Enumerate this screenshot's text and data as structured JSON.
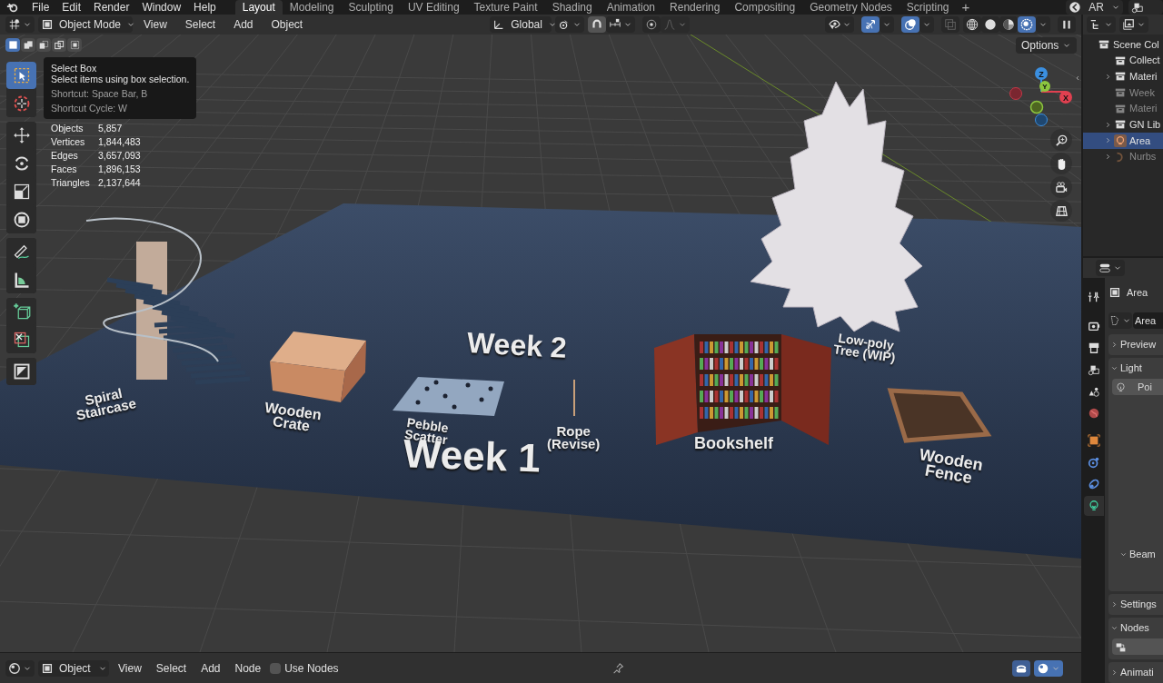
{
  "top_menu": [
    "File",
    "Edit",
    "Render",
    "Window",
    "Help"
  ],
  "workspaces": [
    {
      "label": "Layout",
      "selected": true
    },
    {
      "label": "Modeling",
      "selected": false
    },
    {
      "label": "Sculpting",
      "selected": false
    },
    {
      "label": "UV Editing",
      "selected": false
    },
    {
      "label": "Texture Paint",
      "selected": false
    },
    {
      "label": "Shading",
      "selected": false
    },
    {
      "label": "Animation",
      "selected": false
    },
    {
      "label": "Rendering",
      "selected": false
    },
    {
      "label": "Compositing",
      "selected": false
    },
    {
      "label": "Geometry Nodes",
      "selected": false
    },
    {
      "label": "Scripting",
      "selected": false
    }
  ],
  "add_workspace": "+",
  "scene": {
    "name": "AR"
  },
  "viewport_header": {
    "mode": "Object Mode",
    "menus": [
      "View",
      "Select",
      "Add",
      "Object"
    ],
    "orientation": "Global",
    "snapping": {
      "on": true
    },
    "proportional_editing": {
      "on": false
    },
    "gizmos": {
      "on": true
    },
    "overlays": {
      "on": true
    },
    "xray": {
      "on": false
    },
    "shading": [
      {
        "kind": "wireframe",
        "selected": false
      },
      {
        "kind": "solid",
        "selected": false
      },
      {
        "kind": "material",
        "selected": false
      },
      {
        "kind": "rendered",
        "selected": true
      }
    ]
  },
  "select_modes": [
    {
      "kind": "new",
      "selected": true
    },
    {
      "kind": "extend",
      "selected": false
    },
    {
      "kind": "subtract",
      "selected": false
    },
    {
      "kind": "invert",
      "selected": false
    },
    {
      "kind": "intersect",
      "selected": false
    }
  ],
  "options": "Options",
  "axis_gizmo": [
    "Z",
    "Y",
    "X"
  ],
  "tool_groups": [
    [
      {
        "kind": "select-box",
        "selected": true
      },
      {
        "kind": "cursor",
        "selected": false
      }
    ],
    [
      {
        "kind": "move",
        "selected": false
      },
      {
        "kind": "rotate",
        "selected": false
      },
      {
        "kind": "scale",
        "selected": false
      },
      {
        "kind": "transform",
        "selected": false
      }
    ],
    [
      {
        "kind": "annotate",
        "selected": false
      },
      {
        "kind": "measure",
        "selected": false
      }
    ],
    [
      {
        "kind": "add-cube",
        "selected": false
      },
      {
        "kind": "cut",
        "selected": false
      }
    ],
    [
      {
        "kind": "misc",
        "selected": false
      }
    ]
  ],
  "tooltip": {
    "title": "Select Box",
    "description": "Select items using box selection.",
    "shortcut": "Shortcut: Space Bar, B",
    "cycle": "Shortcut Cycle: W"
  },
  "stats": [
    {
      "label": "Objects",
      "value": "5,857"
    },
    {
      "label": "Vertices",
      "value": "1,844,483"
    },
    {
      "label": "Edges",
      "value": "3,657,093"
    },
    {
      "label": "Faces",
      "value": "1,896,153"
    },
    {
      "label": "Triangles",
      "value": "2,137,644"
    }
  ],
  "scene_labels": [
    {
      "lines": [
        "Spiral",
        "Staircase"
      ]
    },
    {
      "lines": [
        "Wooden",
        "Crate"
      ]
    },
    {
      "lines": [
        "Week 2"
      ]
    },
    {
      "lines": [
        "Pebble",
        "Scatter"
      ]
    },
    {
      "lines": [
        "Week 1"
      ]
    },
    {
      "lines": [
        "Rope",
        "(Revise)"
      ]
    },
    {
      "lines": [
        "Bookshelf"
      ]
    },
    {
      "lines": [
        "Low-poly",
        "Tree (WIP)"
      ]
    },
    {
      "lines": [
        "Wooden",
        "Fence"
      ]
    }
  ],
  "outliner": {
    "items": [
      {
        "label": "Scene Col",
        "kind": "collection",
        "expandable": false,
        "dimmed": false,
        "selected": false,
        "children": [
          {
            "label": "Collect",
            "kind": "collection",
            "expandable": false,
            "dimmed": false,
            "selected": false
          },
          {
            "label": "Materi",
            "kind": "collection",
            "expandable": true,
            "dimmed": false,
            "selected": false
          },
          {
            "label": "Week",
            "kind": "collection",
            "expandable": false,
            "dimmed": true,
            "selected": false
          },
          {
            "label": "Materi",
            "kind": "collection",
            "expandable": false,
            "dimmed": true,
            "selected": false
          },
          {
            "label": "GN Lib",
            "kind": "collection",
            "expandable": true,
            "dimmed": false,
            "selected": false
          },
          {
            "label": "Area",
            "kind": "light",
            "expandable": true,
            "dimmed": false,
            "selected": true
          },
          {
            "label": "Nurbs",
            "kind": "curve",
            "expandable": true,
            "dimmed": true,
            "selected": false
          }
        ]
      }
    ]
  },
  "properties": {
    "tabs": [
      {
        "kind": "tool",
        "selected": false
      },
      {
        "kind": "render",
        "selected": false
      },
      {
        "kind": "output",
        "selected": false
      },
      {
        "kind": "view-layer",
        "selected": false
      },
      {
        "kind": "scene",
        "selected": false
      },
      {
        "kind": "world",
        "selected": false
      },
      {
        "kind": "object",
        "selected": false
      },
      {
        "kind": "physics",
        "selected": false
      },
      {
        "kind": "constraints",
        "selected": false
      },
      {
        "kind": "data",
        "selected": true
      }
    ],
    "object_name": "Area",
    "data_name": "Area",
    "panels": [
      {
        "title": "Preview",
        "expanded": false
      },
      {
        "title": "Light",
        "expanded": true,
        "button": "Poi",
        "subpanel": {
          "title": "Beam",
          "expanded": true
        }
      },
      {
        "title": "Settings",
        "expanded": false
      },
      {
        "title": "Nodes",
        "expanded": true
      },
      {
        "title": "Animati",
        "expanded": false
      }
    ]
  },
  "shader_header": {
    "object": "Object",
    "menus": [
      "View",
      "Select",
      "Add",
      "Node"
    ],
    "use_nodes": {
      "label": "Use Nodes",
      "checked": false
    }
  }
}
